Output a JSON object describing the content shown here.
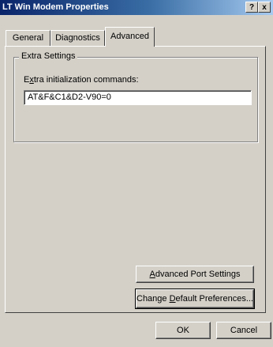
{
  "window": {
    "title": "LT Win Modem Properties",
    "help_button": "?",
    "close_button": "x"
  },
  "tabs": [
    {
      "label": "General"
    },
    {
      "label": "Diagnostics"
    },
    {
      "label": "Advanced"
    }
  ],
  "extra_settings": {
    "group_title": "Extra Settings",
    "label_underlined_char": "x",
    "label_pre": "E",
    "label_post": "tra initialization commands:",
    "value": "AT&F&C1&D2-V90=0"
  },
  "buttons": {
    "advanced_port_settings": {
      "pre": "",
      "u": "A",
      "post": "dvanced Port Settings"
    },
    "change_default_preferences": {
      "pre": "Change ",
      "u": "D",
      "post": "efault Preferences..."
    },
    "ok": "OK",
    "cancel": "Cancel"
  }
}
